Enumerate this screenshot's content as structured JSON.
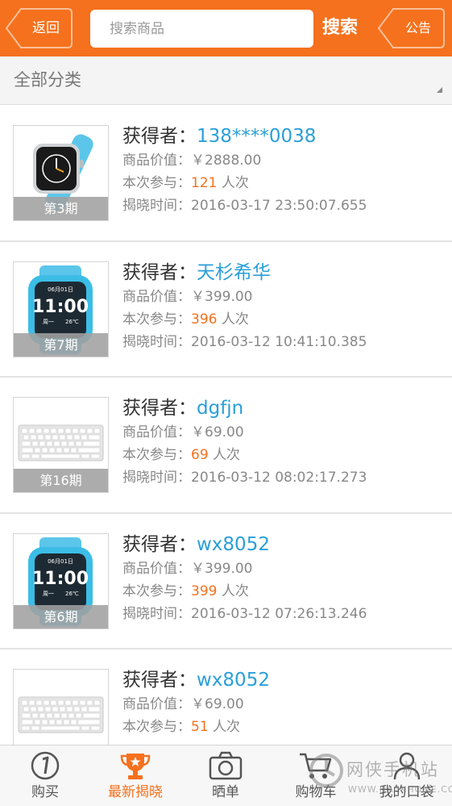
{
  "header": {
    "back_label": "返回",
    "search_placeholder": "搜索商品",
    "search_label": "搜索",
    "notice_label": "公告"
  },
  "category": {
    "label": "全部分类"
  },
  "labels": {
    "winner": "获得者：",
    "value": "商品价值：",
    "participate": "本次参与：",
    "participate_unit": "人次",
    "reveal_time": "揭晓时间："
  },
  "items": [
    {
      "period": "第3期",
      "winner": "138****0038",
      "value": "￥2888.00",
      "count": "121",
      "time": "2016-03-17 23:50:07.655",
      "product_icon": "smartwatch-blue-icon"
    },
    {
      "period": "第7期",
      "winner": "天杉希华",
      "value": "￥399.00",
      "count": "396",
      "time": "2016-03-12 10:41:10.385",
      "product_icon": "kids-watch-icon"
    },
    {
      "period": "第16期",
      "winner": "dgfjn",
      "value": "￥69.00",
      "count": "69",
      "time": "2016-03-12 08:02:17.273",
      "product_icon": "keyboard-icon"
    },
    {
      "period": "第6期",
      "winner": "wx8052",
      "value": "￥399.00",
      "count": "399",
      "time": "2016-03-12 07:26:13.246",
      "product_icon": "kids-watch-icon"
    },
    {
      "period": "",
      "winner": "wx8052",
      "value": "￥69.00",
      "count": "51",
      "time": "",
      "product_icon": "keyboard-icon"
    }
  ],
  "watch_face": {
    "time": "11:00",
    "date": "06月01日",
    "weekday": "周一",
    "temp": "26℃"
  },
  "nav": [
    {
      "label": "购买",
      "icon": "buy-icon"
    },
    {
      "label": "最新揭晓",
      "icon": "trophy-icon",
      "active": true
    },
    {
      "label": "晒单",
      "icon": "camera-icon"
    },
    {
      "label": "购物车",
      "icon": "cart-icon"
    },
    {
      "label": "我的口袋",
      "icon": "user-icon"
    }
  ],
  "watermark": {
    "text": "网侠手机站",
    "url": "WWW.HACKHOME.COM"
  },
  "colors": {
    "accent": "#f5711d",
    "link": "#2a9fd8",
    "text": "#333333",
    "muted": "#888888"
  }
}
